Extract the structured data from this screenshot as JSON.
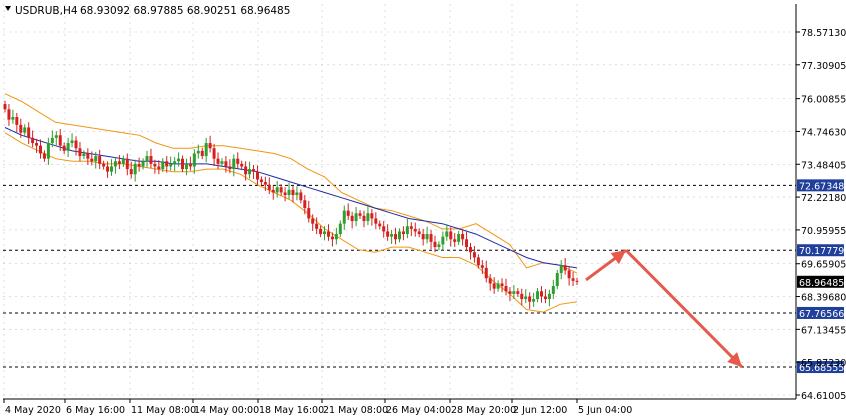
{
  "window": {
    "symbol_label": "USDRUB,H4",
    "ohlc_text": "68.93092 68.97885 68.90251 68.96485"
  },
  "colors": {
    "background": "#ffffff",
    "bull": "#2e9e2e",
    "bear": "#d42020",
    "bollinger": "#f0960f",
    "moving_average": "#1f2ba8",
    "grid": "#c8c8c8",
    "level_line": "#000000",
    "price_label_bg": "#1f3f9a",
    "current_label_bg": "#000000",
    "arrow": "#e55a4a"
  },
  "chart_data": {
    "type": "candlestick",
    "symbol": "USDRUB",
    "timeframe": "H4",
    "ylim": [
      64.6,
      79.8
    ],
    "y_ticks": [
      "78.57130",
      "77.30905",
      "76.00855",
      "74.74630",
      "73.48405",
      "72.22180",
      "70.95955",
      "69.65905",
      "68.39680",
      "67.13455",
      "65.87230",
      "64.61005"
    ],
    "x_ticks": [
      "4 May 2020",
      "6 May 16:00",
      "11 May 08:00",
      "14 May 00:00",
      "18 May 16:00",
      "21 May 08:00",
      "26 May 04:00",
      "28 May 20:00",
      "2 Jun 12:00",
      "5 Jun 04:00"
    ],
    "levels": [
      "72.67348",
      "70.17779",
      "67.76566",
      "65.68555"
    ],
    "current_price": "68.96485",
    "closes": [
      75.6,
      75.2,
      75.3,
      75.0,
      74.7,
      74.9,
      74.5,
      74.3,
      74.2,
      73.9,
      73.7,
      74.3,
      74.5,
      74.6,
      74.2,
      74.0,
      74.3,
      74.4,
      74.1,
      73.8,
      73.9,
      73.7,
      73.6,
      73.8,
      73.5,
      73.4,
      73.2,
      73.4,
      73.6,
      73.5,
      73.7,
      73.3,
      73.1,
      73.5,
      73.4,
      73.6,
      73.8,
      73.5,
      73.4,
      73.3,
      73.6,
      73.4,
      73.5,
      73.6,
      73.7,
      73.3,
      73.5,
      73.4,
      73.9,
      74.0,
      73.8,
      74.3,
      74.1,
      73.7,
      73.5,
      73.6,
      73.4,
      73.3,
      73.7,
      73.5,
      73.4,
      73.1,
      73.3,
      73.2,
      72.9,
      72.8,
      72.7,
      72.5,
      72.4,
      72.6,
      72.4,
      72.3,
      72.5,
      72.3,
      72.4,
      72.1,
      71.8,
      71.4,
      71.2,
      71.0,
      70.8,
      70.9,
      70.7,
      70.6,
      70.8,
      71.2,
      71.7,
      71.5,
      71.3,
      71.6,
      71.5,
      71.3,
      71.6,
      71.4,
      71.2,
      71.1,
      70.9,
      70.7,
      70.8,
      70.6,
      70.9,
      70.8,
      71.1,
      71.0,
      70.9,
      70.8,
      70.6,
      70.8,
      70.5,
      70.3,
      70.4,
      70.7,
      70.9,
      70.6,
      70.5,
      70.8,
      70.6,
      70.3,
      70.1,
      69.9,
      69.6,
      69.5,
      69.1,
      68.9,
      68.7,
      68.9,
      68.8,
      68.6,
      68.5,
      68.6,
      68.5,
      68.3,
      68.4,
      68.2,
      68.3,
      68.6,
      68.4,
      68.3,
      68.5,
      68.8,
      69.3,
      69.6,
      69.4,
      69.1,
      69.0,
      68.96
    ],
    "bollinger_upper": [
      76.2,
      75.9,
      75.5,
      75.1,
      75.0,
      74.9,
      74.8,
      74.7,
      74.6,
      74.3,
      74.1,
      74.1,
      74.2,
      74.2,
      74.1,
      74.0,
      73.9,
      73.7,
      73.3,
      73.0,
      72.4,
      72.1,
      71.8,
      71.7,
      71.5,
      71.3,
      71.0,
      71.0,
      71.2,
      70.8,
      70.4,
      69.5,
      69.7,
      69.6,
      69.3
    ],
    "bollinger_lower": [
      74.7,
      74.3,
      74.0,
      73.7,
      73.6,
      73.6,
      73.5,
      73.5,
      73.4,
      73.3,
      73.2,
      73.2,
      73.3,
      73.3,
      73.1,
      72.7,
      72.4,
      72.1,
      71.6,
      71.0,
      70.6,
      70.2,
      70.1,
      70.3,
      70.3,
      70.1,
      69.9,
      69.9,
      69.6,
      69.0,
      68.5,
      67.9,
      67.8,
      68.1,
      68.2
    ],
    "moving_average": [
      74.9,
      74.6,
      74.4,
      74.2,
      74.0,
      73.9,
      73.8,
      73.7,
      73.6,
      73.6,
      73.5,
      73.5,
      73.5,
      73.4,
      73.3,
      73.2,
      73.0,
      72.8,
      72.6,
      72.4,
      72.2,
      72.0,
      71.8,
      71.6,
      71.4,
      71.3,
      71.2,
      71.0,
      70.8,
      70.5,
      70.2,
      69.9,
      69.7,
      69.6,
      69.5
    ]
  }
}
